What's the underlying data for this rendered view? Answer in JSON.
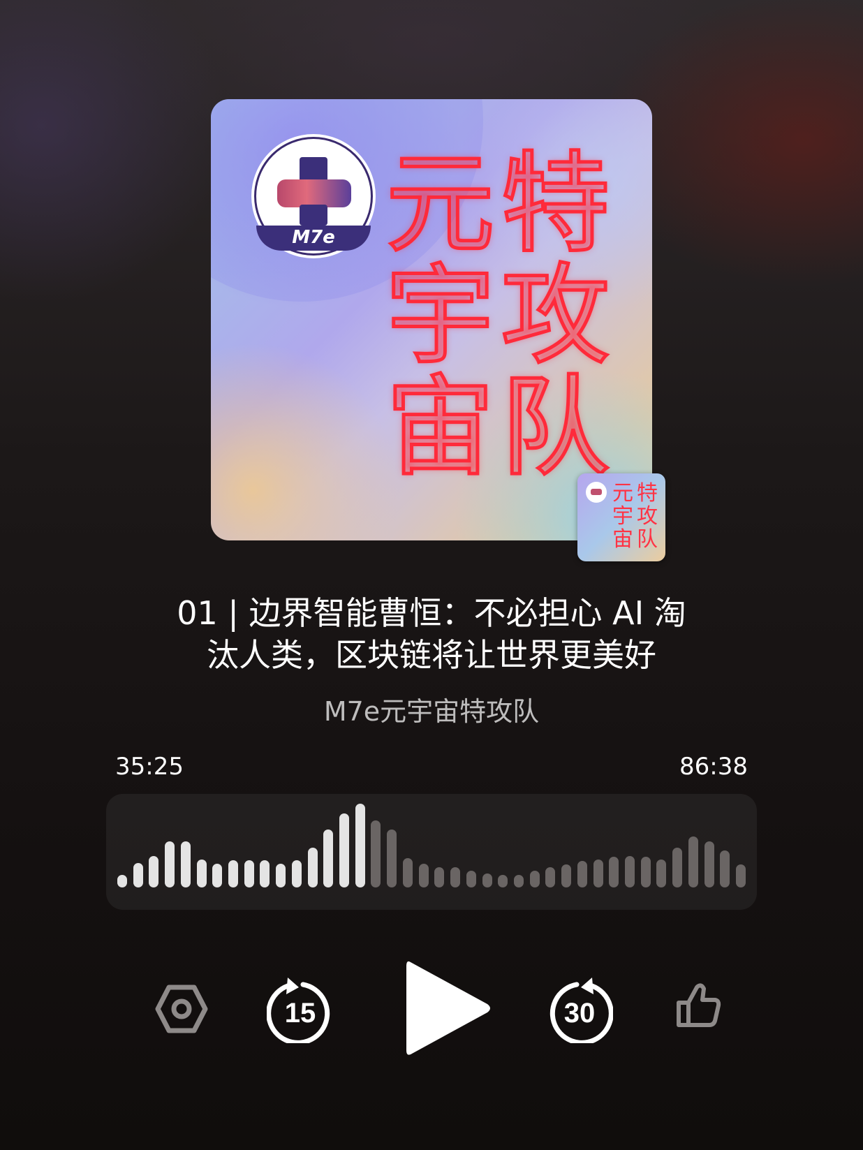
{
  "artwork": {
    "logo_text": "M7e",
    "title_chars": [
      "元",
      "特",
      "宇",
      "攻",
      "宙",
      "队"
    ]
  },
  "episode": {
    "title_line1": "01 | 边界智能曹恒：不必担心 AI 淘",
    "title_line2": "汰人类，区块链将让世界更美好",
    "podcast": "M7e元宇宙特攻队"
  },
  "playback": {
    "elapsed": "35:25",
    "total": "86:38",
    "progress": 0.409
  },
  "waveform": {
    "levels": [
      0.14,
      0.28,
      0.36,
      0.52,
      0.52,
      0.32,
      0.27,
      0.31,
      0.31,
      0.31,
      0.27,
      0.31,
      0.45,
      0.66,
      0.84,
      0.95,
      0.76,
      0.66,
      0.33,
      0.27,
      0.23,
      0.23,
      0.19,
      0.16,
      0.14,
      0.14,
      0.19,
      0.23,
      0.26,
      0.3,
      0.32,
      0.35,
      0.36,
      0.35,
      0.32,
      0.45,
      0.58,
      0.52,
      0.42,
      0.26
    ],
    "played_color": "#e4e4e4",
    "unplayed_color": "#6a6564"
  },
  "controls": {
    "skip_back_label": "15",
    "skip_forward_label": "30",
    "icons": [
      "settings-hexagon-icon",
      "skip-back-15-icon",
      "play-icon",
      "skip-forward-30-icon",
      "thumbs-up-icon"
    ]
  }
}
